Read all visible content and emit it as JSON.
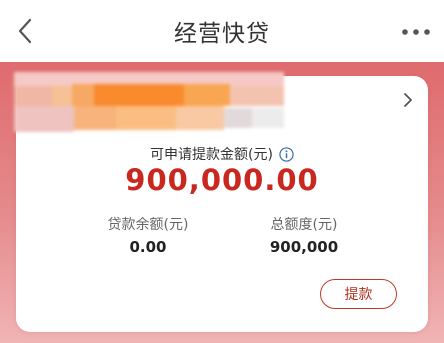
{
  "header": {
    "title": "经营快贷",
    "back_icon": "chevron-left-icon",
    "more_icon": "more-horizontal-icon"
  },
  "loan_card": {
    "available_label": "可申请提款金额(元)",
    "available_amount": "900,000.00",
    "balance_label": "贷款余额(元)",
    "balance_value": "0.00",
    "total_label": "总额度(元)",
    "total_value": "900,000",
    "withdraw_label": "提款"
  },
  "colors": {
    "accent": "#c8281f",
    "hero_top": "#df6b6d",
    "hero_bottom": "#f1b4b5"
  }
}
